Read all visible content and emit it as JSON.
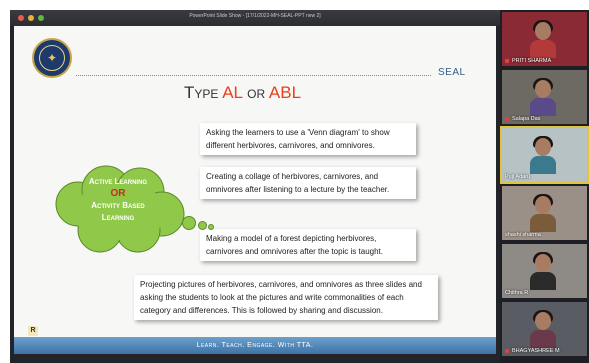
{
  "window": {
    "title": "PowerPoint Slide Show - [17/1/2022-MH-SEAL-PPT new 2]"
  },
  "slide": {
    "brand": "SEAL",
    "title_prefix": "Type",
    "title_al": "AL",
    "title_or": "or",
    "title_abl": "ABL",
    "cloud": {
      "line1": "Active Learning",
      "line2": "OR",
      "line3": "Activity Based",
      "line4": "Learning"
    },
    "activities": [
      "Asking the learners to use a 'Venn diagram' to show different herbivores, carnivores, and omnivores.",
      "Creating a collage of herbivores, carnivores, and omnivores after listening to a lecture by the teacher.",
      "Making a model of a forest depicting herbivores, carnivores and omnivores after the topic is taught.",
      "Projecting pictures of herbivores, carnivores, and omnivores as three slides and asking the students to look at the pictures and write commonalities of each category and differences. This is followed by sharing and discussion."
    ],
    "footer": "Learn. Teach. Engage. With TTA.",
    "presenter_badge": "R"
  },
  "participants": [
    {
      "name": "PRITI SHARMA",
      "bg": "#8a2a35",
      "shirt": "#b23a3a"
    },
    {
      "name": "Salapa Das",
      "bg": "#6d6a64",
      "shirt": "#5b4a8a"
    },
    {
      "name": "Puji Adaru",
      "bg": "#b7c2c4",
      "shirt": "#3a7a8c"
    },
    {
      "name": "shashi sharma",
      "bg": "#9a9088",
      "shirt": "#7a5b3a"
    },
    {
      "name": "Chithra R",
      "bg": "#8e8a86",
      "shirt": "#2a2a2a"
    },
    {
      "name": "BHAGYASHREE M",
      "bg": "#5a5c64",
      "shirt": "#6a3a4a"
    }
  ],
  "colors": {
    "accent": "#e84020",
    "seal_blue": "#2f5f8a",
    "cloud_green": "#90c84a",
    "footer_blue": "#3d72a6"
  }
}
